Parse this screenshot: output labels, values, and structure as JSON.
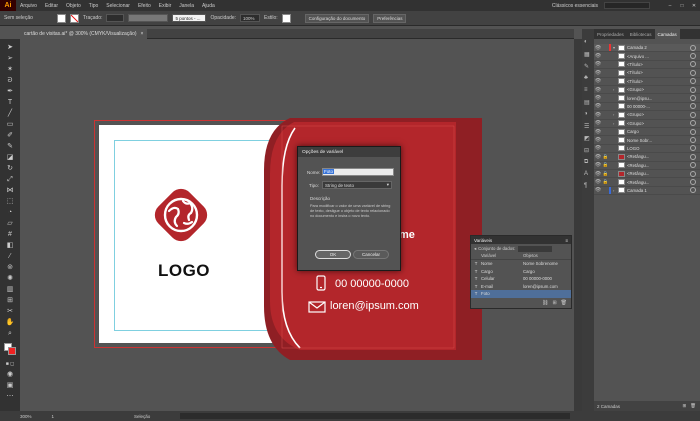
{
  "app": {
    "logo": "Ai"
  },
  "menu": [
    "Arquivo",
    "Editar",
    "Objeto",
    "Tipo",
    "Selecionar",
    "Efeito",
    "Exibir",
    "Janela",
    "Ajuda"
  ],
  "workspace": "Clássicos essenciais",
  "control": {
    "selection_label": "Sem seleção",
    "stroke_label": "Traçado:",
    "brush_value": "5 pontos - ...",
    "opacity_label": "Opacidade:",
    "opacity_value": "100%",
    "style_label": "Estilo:",
    "doc_setup": "Configuração do documento",
    "prefs": "Preferências"
  },
  "doc_tab": {
    "title": "cartão de visitas.ai* @ 300% (CMYK/Visualização)",
    "close": "×"
  },
  "status": {
    "zoom": "300%",
    "page": "1",
    "mode": "Seleção",
    "layers_count": "2 Camadas"
  },
  "panel_tabs": [
    "Propriedades",
    "Bibliotecas",
    "Camadas"
  ],
  "layers": [
    {
      "name": "Camada 2",
      "thumb": "#ffffff",
      "bar": "#e33",
      "sel": true,
      "arrow": "▾",
      "lock": ""
    },
    {
      "name": "<Arquivo ...",
      "thumb": "#ffffff",
      "bar": "",
      "sel": false,
      "arrow": "",
      "lock": ""
    },
    {
      "name": "<Título>",
      "thumb": "#ffffff",
      "bar": "",
      "sel": false,
      "arrow": "",
      "lock": ""
    },
    {
      "name": "<Título>",
      "thumb": "#ffffff",
      "bar": "",
      "sel": false,
      "arrow": "",
      "lock": ""
    },
    {
      "name": "<Título>",
      "thumb": "#ffffff",
      "bar": "",
      "sel": false,
      "arrow": "",
      "lock": ""
    },
    {
      "name": "<Grupo>",
      "thumb": "#ffffff",
      "bar": "",
      "sel": false,
      "arrow": "›",
      "lock": ""
    },
    {
      "name": "loren@ipsu...",
      "thumb": "#ffffff",
      "bar": "",
      "sel": false,
      "arrow": "",
      "lock": ""
    },
    {
      "name": "00 00000-...",
      "thumb": "#ffffff",
      "bar": "",
      "sel": false,
      "arrow": "",
      "lock": ""
    },
    {
      "name": "<Grupo>",
      "thumb": "#ffffff",
      "bar": "",
      "sel": false,
      "arrow": "›",
      "lock": ""
    },
    {
      "name": "<Grupo>",
      "thumb": "#ffffff",
      "bar": "",
      "sel": false,
      "arrow": "›",
      "lock": ""
    },
    {
      "name": "Cargo",
      "thumb": "#ffffff",
      "bar": "",
      "sel": false,
      "arrow": "",
      "lock": ""
    },
    {
      "name": "Nome Sobr...",
      "thumb": "#ffffff",
      "bar": "",
      "sel": false,
      "arrow": "",
      "lock": ""
    },
    {
      "name": "LOGO",
      "thumb": "#ffffff",
      "bar": "",
      "sel": false,
      "arrow": "",
      "lock": ""
    },
    {
      "name": "<Retângu...",
      "thumb": "#b3262b",
      "bar": "",
      "sel": false,
      "arrow": "",
      "lock": "🔒"
    },
    {
      "name": "<Retângu...",
      "thumb": "#ffffff",
      "bar": "",
      "sel": false,
      "arrow": "",
      "lock": "🔒"
    },
    {
      "name": "<Retângu...",
      "thumb": "#b3262b",
      "bar": "",
      "sel": false,
      "arrow": "",
      "lock": "🔒"
    },
    {
      "name": "<Retângu...",
      "thumb": "#ffffff",
      "bar": "",
      "sel": false,
      "arrow": "",
      "lock": "🔒"
    },
    {
      "name": "Camada 1",
      "thumb": "#ffffff",
      "bar": "#3a6bd8",
      "sel": false,
      "arrow": "›",
      "lock": ""
    }
  ],
  "variables_panel": {
    "title": "Variáveis",
    "dataset_label": "Conjunto de dados:",
    "col_var": "Variável",
    "col_obj": "Objetos",
    "rows": [
      {
        "type": "T",
        "var": "Nome",
        "obj": "Nome Sobrenome"
      },
      {
        "type": "T",
        "var": "Cargo",
        "obj": "Cargo"
      },
      {
        "type": "T",
        "var": "Celular",
        "obj": "00 00000-0000"
      },
      {
        "type": "T",
        "var": "E-mail",
        "obj": "loren@ipsum.com"
      },
      {
        "type": "T",
        "var": "Foto",
        "obj": ""
      }
    ]
  },
  "card": {
    "logo_text": "LOGO",
    "name_partial": "me",
    "phone": "00 00000-0000",
    "email": "loren@ipsum.com",
    "colors": {
      "red": "#b3262b",
      "dark_red": "#8f1f24",
      "white": "#ffffff"
    }
  },
  "dialog": {
    "title": "Opções de variável",
    "name_label": "Nome:",
    "name_value": "Foto",
    "type_label": "Tipo:",
    "type_value": "String de texto",
    "desc_label": "Descrição",
    "desc_text": "Para modificar o valor de uma variável de string de texto, desligue o objeto de texto relacionado no documento e insira o novo texto.",
    "ok": "OK",
    "cancel": "Cancelar"
  }
}
